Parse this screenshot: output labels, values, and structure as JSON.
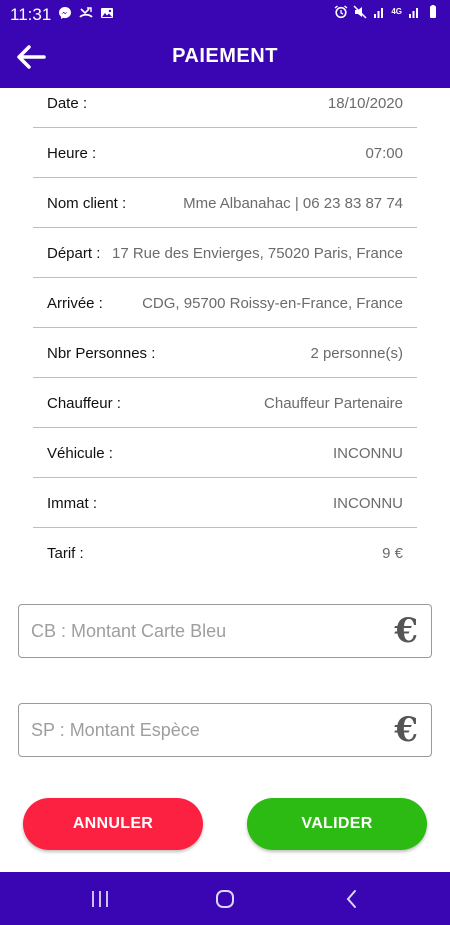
{
  "status_bar": {
    "time": "11:31",
    "network": "4G",
    "left_icons": [
      "messenger-icon",
      "missed-call-icon",
      "gallery-icon"
    ],
    "right_icons": [
      "alarm-icon",
      "mute-icon",
      "signal-icon",
      "signal-icon",
      "battery-icon"
    ]
  },
  "header": {
    "title": "PAIEMENT",
    "back_icon": "arrow-left-icon"
  },
  "details": [
    {
      "label": "Date :",
      "value": "18/10/2020"
    },
    {
      "label": "Heure :",
      "value": "07:00"
    },
    {
      "label": "Nom client :",
      "value": "Mme Albanahac | 06 23 83 87 74"
    },
    {
      "label": "Départ :",
      "value": "17 Rue des Envierges, 75020 Paris, France"
    },
    {
      "label": "Arrivée :",
      "value": "CDG, 95700 Roissy-en-France, France"
    },
    {
      "label": "Nbr Personnes :",
      "value": "2  personne(s)"
    },
    {
      "label": "Chauffeur :",
      "value": "Chauffeur Partenaire"
    },
    {
      "label": "Véhicule :",
      "value": "INCONNU"
    },
    {
      "label": "Immat :",
      "value": "INCONNU"
    },
    {
      "label": "Tarif :",
      "value": "9  €"
    }
  ],
  "payment": {
    "card_placeholder": "CB : Montant Carte Bleu",
    "card_value": "",
    "cash_placeholder": "SP : Montant Espèce",
    "cash_value": "",
    "currency_symbol": "€"
  },
  "actions": {
    "cancel_label": "ANNULER",
    "validate_label": "VALIDER"
  },
  "nav_bar": {
    "icons": [
      "recent-apps-icon",
      "home-icon",
      "back-icon"
    ]
  },
  "colors": {
    "primary": "#3a06b3",
    "cancel": "#fd2141",
    "validate": "#2bbb13"
  }
}
